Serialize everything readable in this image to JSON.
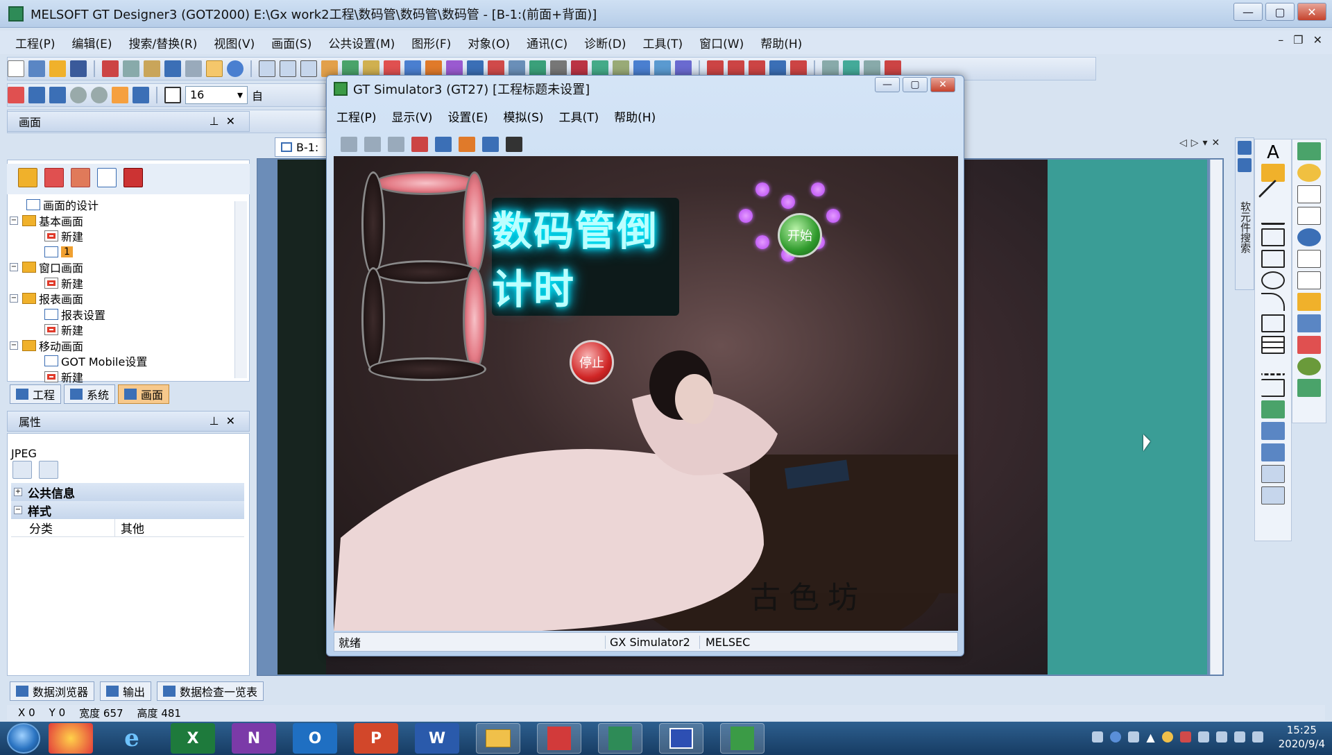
{
  "window": {
    "title": "MELSOFT GT Designer3 (GOT2000) E:\\Gx work2工程\\数码管\\数码管\\数码管 - [B-1:(前面+背面)]",
    "controls": [
      "—",
      "▢",
      "✕"
    ]
  },
  "menu": [
    "工程(P)",
    "编辑(E)",
    "搜索/替换(R)",
    "视图(V)",
    "画面(S)",
    "公共设置(M)",
    "图形(F)",
    "对象(O)",
    "通讯(C)",
    "诊断(D)",
    "工具(T)",
    "窗口(W)",
    "帮助(H)"
  ],
  "toolbar2": {
    "font_size": "16",
    "font_size_suffix": "自"
  },
  "screen_panel": {
    "title": "画面",
    "tree": [
      {
        "label": "画面的设计",
        "level": 1
      },
      {
        "label": "基本画面",
        "level": 0
      },
      {
        "label": "新建",
        "level": 2
      },
      {
        "label": "1",
        "level": 2
      },
      {
        "label": "窗口画面",
        "level": 0
      },
      {
        "label": "新建",
        "level": 2
      },
      {
        "label": "报表画面",
        "level": 0
      },
      {
        "label": "报表设置",
        "level": 2
      },
      {
        "label": "新建",
        "level": 2
      },
      {
        "label": "移动画面",
        "level": 0
      },
      {
        "label": "GOT Mobile设置",
        "level": 2
      },
      {
        "label": "新建",
        "level": 2
      }
    ],
    "tabs": [
      "工程",
      "系统",
      "画面"
    ]
  },
  "property_panel": {
    "title": "属性",
    "type": "JPEG",
    "categories": [
      "公共信息",
      "样式"
    ],
    "rows": [
      {
        "key": "分类",
        "value": "其他"
      }
    ]
  },
  "doc_tab": "B-1:",
  "right_vertical_label": "软元件搜索",
  "bottom_tabs": [
    "数据浏览器",
    "输出",
    "数据检查一览表"
  ],
  "status_ide": {
    "x_label": "X",
    "x": "0",
    "y_label": "Y",
    "y": "0",
    "width_label": "宽度",
    "width": "657",
    "height_label": "高度",
    "height": "481"
  },
  "simulator": {
    "title": "GT Simulator3 (GT27)  [工程标题未设置]",
    "menu": [
      "工程(P)",
      "显示(V)",
      "设置(E)",
      "模拟(S)",
      "工具(T)",
      "帮助(H)"
    ],
    "hmi_title": "数码管倒计时",
    "start_label": "开始",
    "stop_label": "停止",
    "watermark": "古色坊",
    "status": {
      "ready": "就绪",
      "link": "GX Simulator2",
      "vendor": "MELSEC"
    }
  },
  "taskbar": {
    "apps": [
      {
        "name": "start-orb"
      },
      {
        "name": "360-icon"
      },
      {
        "name": "ie-icon",
        "glyph": "e"
      },
      {
        "name": "excel-icon",
        "glyph": "X"
      },
      {
        "name": "onenote-icon",
        "glyph": "N"
      },
      {
        "name": "outlook-icon",
        "glyph": "O"
      },
      {
        "name": "powerpoint-icon",
        "glyph": "P"
      },
      {
        "name": "word-icon",
        "glyph": "W"
      },
      {
        "name": "explorer-icon"
      },
      {
        "name": "gx-works-icon"
      },
      {
        "name": "gt-designer-icon"
      },
      {
        "name": "app-blue-icon"
      },
      {
        "name": "gt-simulator-icon"
      }
    ],
    "time": "15:25",
    "date": "2020/9/4"
  },
  "colors": {
    "accent": "#b6cde8",
    "teal": "#3a9d96",
    "neon": "#00f0ff"
  }
}
